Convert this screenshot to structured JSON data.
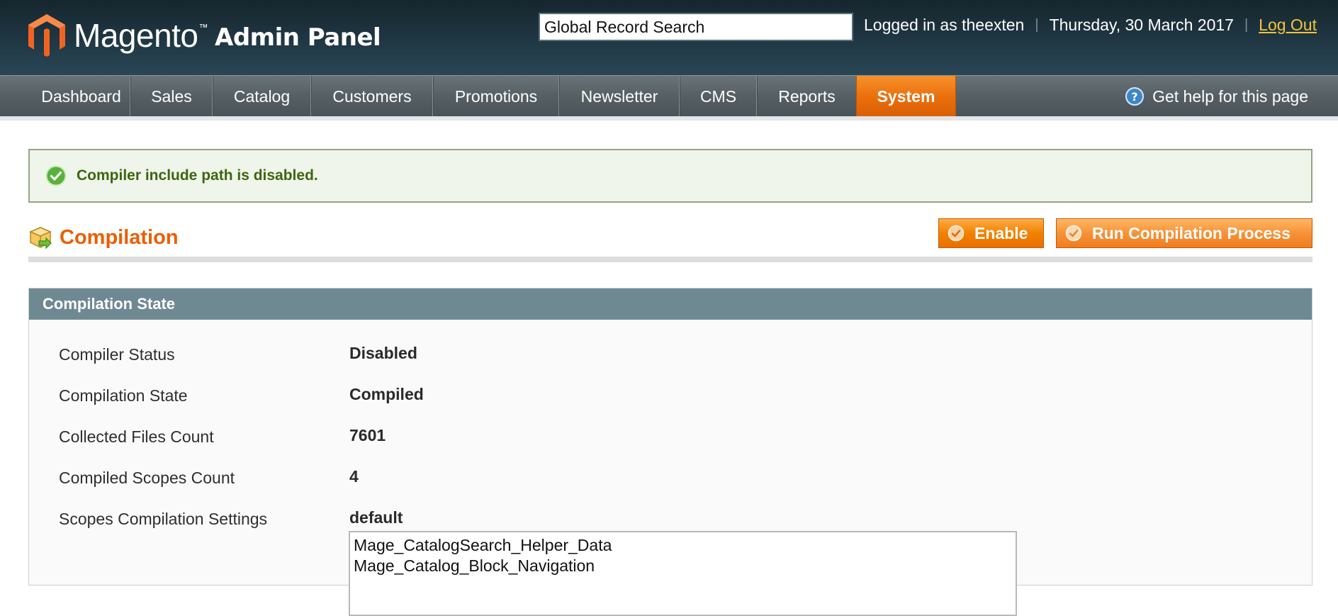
{
  "header": {
    "logo_brand": "Magento",
    "logo_tm": "™",
    "logo_suffix": "Admin Panel",
    "search_value": "Global Record Search",
    "logged_in_text": "Logged in as theexten",
    "date_text": "Thursday, 30 March 2017",
    "separator": "|",
    "logout_label": "Log Out"
  },
  "nav": {
    "items": [
      {
        "label": "Dashboard",
        "name": "dashboard",
        "active": false
      },
      {
        "label": "Sales",
        "name": "sales",
        "active": false
      },
      {
        "label": "Catalog",
        "name": "catalog",
        "active": false
      },
      {
        "label": "Customers",
        "name": "customers",
        "active": false
      },
      {
        "label": "Promotions",
        "name": "promotions",
        "active": false
      },
      {
        "label": "Newsletter",
        "name": "newsletter",
        "active": false
      },
      {
        "label": "CMS",
        "name": "cms",
        "active": false
      },
      {
        "label": "Reports",
        "name": "reports",
        "active": false
      },
      {
        "label": "System",
        "name": "system",
        "active": true
      }
    ],
    "help_label": "Get help for this page"
  },
  "message": {
    "text": "Compiler include path is disabled.",
    "type": "success"
  },
  "page": {
    "title": "Compilation",
    "enable_button": "Enable",
    "run_button": "Run Compilation Process"
  },
  "section": {
    "title": "Compilation State",
    "rows": [
      {
        "label": "Compiler Status",
        "value": "Disabled"
      },
      {
        "label": "Compilation State",
        "value": "Compiled"
      },
      {
        "label": "Collected Files Count",
        "value": "7601"
      },
      {
        "label": "Compiled Scopes Count",
        "value": "4"
      },
      {
        "label": "Scopes Compilation Settings",
        "value": "default"
      }
    ],
    "scope_list": [
      "Mage_CatalogSearch_Helper_Data",
      "Mage_Catalog_Block_Navigation"
    ]
  },
  "colors": {
    "accent": "#eb5e00",
    "header_bg": "#1e3440",
    "nav_bg": "#566064",
    "active_tab": "#ea6d0a",
    "success_text": "#3d6611",
    "section_head": "#6f8992",
    "logout_link": "#f6c33a"
  },
  "icons": {
    "logo": "magento-logo-icon",
    "help": "help-question-icon",
    "success": "success-check-icon",
    "title": "compilation-box-icon",
    "button": "check-circle-icon"
  }
}
